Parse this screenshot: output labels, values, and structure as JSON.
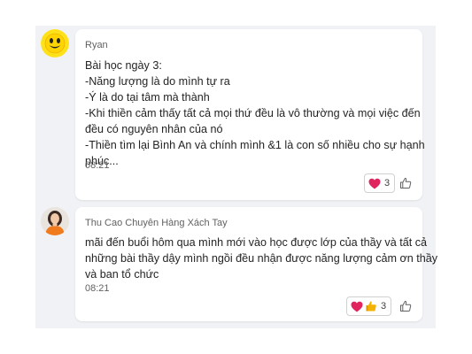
{
  "messages": [
    {
      "author": "Ryan",
      "avatar": "smiley-face-avatar",
      "lines": [
        "Bài học ngày 3:",
        "-Năng lượng là do mình tự ra",
        "-Ý là do tại tâm mà thành",
        "-Khi thiền cảm thấy tất cả mọi thứ đều là vô thường và mọi việc đến",
        "đều có nguyên nhân của nó",
        "-Thiền tìm lại Bình An và chính mình &1 là con số nhiều cho sự hạnh",
        "phúc..."
      ],
      "time": "08:21",
      "reactions": {
        "icons": [
          "heart-icon"
        ],
        "count": "3"
      },
      "like_icon": "thumbs-up-outline-icon"
    },
    {
      "author": "Thu Cao Chuyên Hàng Xách Tay",
      "avatar": "woman-photo-avatar",
      "lines": [
        "mãi đến buổi hôm qua mình mới vào học được lớp của thầy và tất cả",
        "những bài thầy dậy mình ngồi đều nhận được năng lượng cảm ơn thầy",
        "và ban tổ chức"
      ],
      "time": "08:21",
      "reactions": {
        "icons": [
          "heart-icon",
          "thumbs-up-icon"
        ],
        "count": "3"
      },
      "like_icon": "thumbs-up-outline-icon"
    }
  ],
  "colors": {
    "panel": "#f0f2f5",
    "card": "#ffffff",
    "heart": "#e0245e",
    "thumbs": "#f5b100"
  }
}
